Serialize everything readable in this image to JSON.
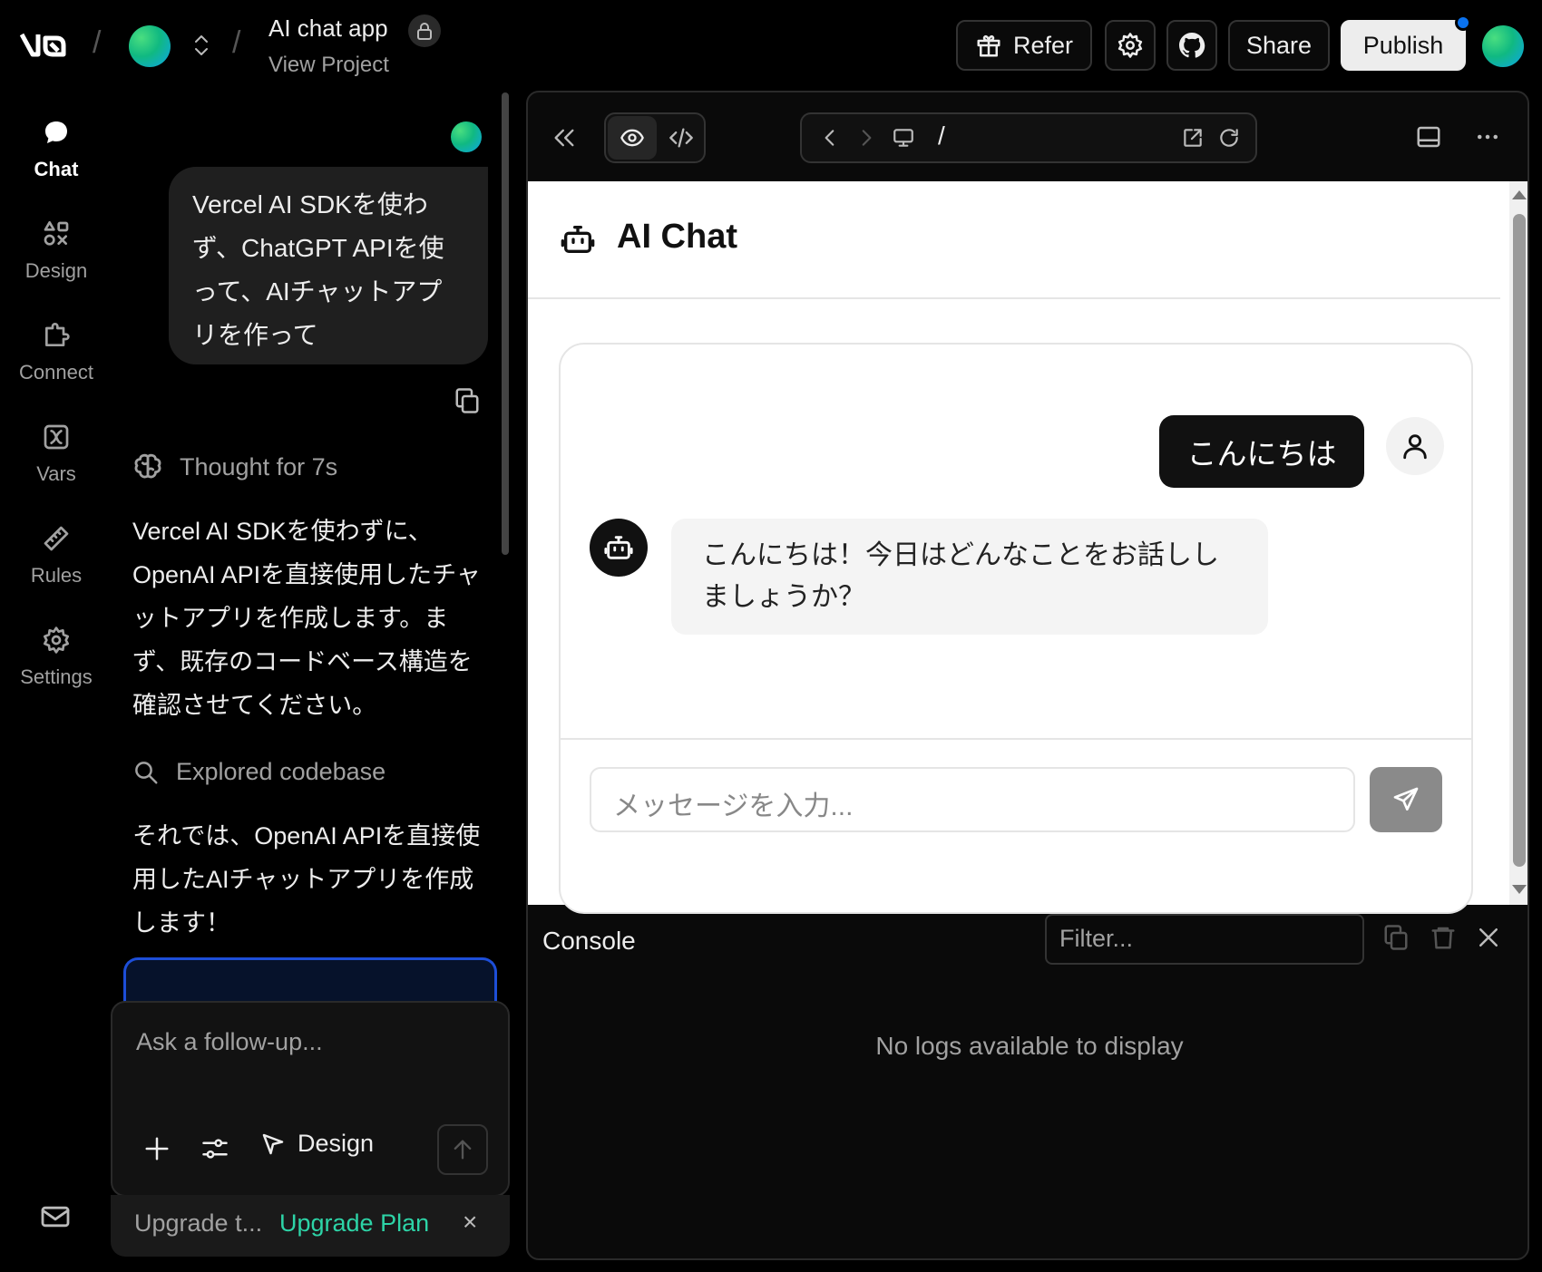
{
  "project": {
    "title": "AI chat app",
    "subtitle": "View Project"
  },
  "header": {
    "refer_label": "Refer",
    "share_label": "Share",
    "publish_label": "Publish"
  },
  "nav": {
    "items": [
      {
        "label": "Chat",
        "icon": "chat-bubble-icon"
      },
      {
        "label": "Design",
        "icon": "shapes-icon"
      },
      {
        "label": "Connect",
        "icon": "puzzle-icon"
      },
      {
        "label": "Vars",
        "icon": "variable-icon"
      },
      {
        "label": "Rules",
        "icon": "ruler-icon"
      },
      {
        "label": "Settings",
        "icon": "gear-icon"
      }
    ]
  },
  "chat": {
    "user_message": "Vercel AI SDKを使わず、ChatGPT APIを使って、AIチャットアプリを作って",
    "thought": "Thought for 7s",
    "response_1": "Vercel AI SDKを使わずに、OpenAI APIを直接使用したチャットアプリを作成します。まず、既存のコードベース構造を確認させてください。",
    "explored": "Explored codebase",
    "response_2": "それでは、OpenAI APIを直接使用したAIチャットアプリを作成します！",
    "prompt_placeholder": "Ask a follow-up...",
    "design_label": "Design",
    "upgrade_text": "Upgrade t...",
    "upgrade_link": "Upgrade Plan",
    "close_glyph": "×"
  },
  "preview": {
    "url_path": "/",
    "app_title": "AI Chat",
    "user_bubble": "こんにちは",
    "bot_bubble": "こんにちは！今日はどんなことをお話ししましょうか？",
    "input_placeholder": "メッセージを入力..."
  },
  "console": {
    "title": "Console",
    "filter_placeholder": "Filter...",
    "empty_text": "No logs available to display"
  }
}
